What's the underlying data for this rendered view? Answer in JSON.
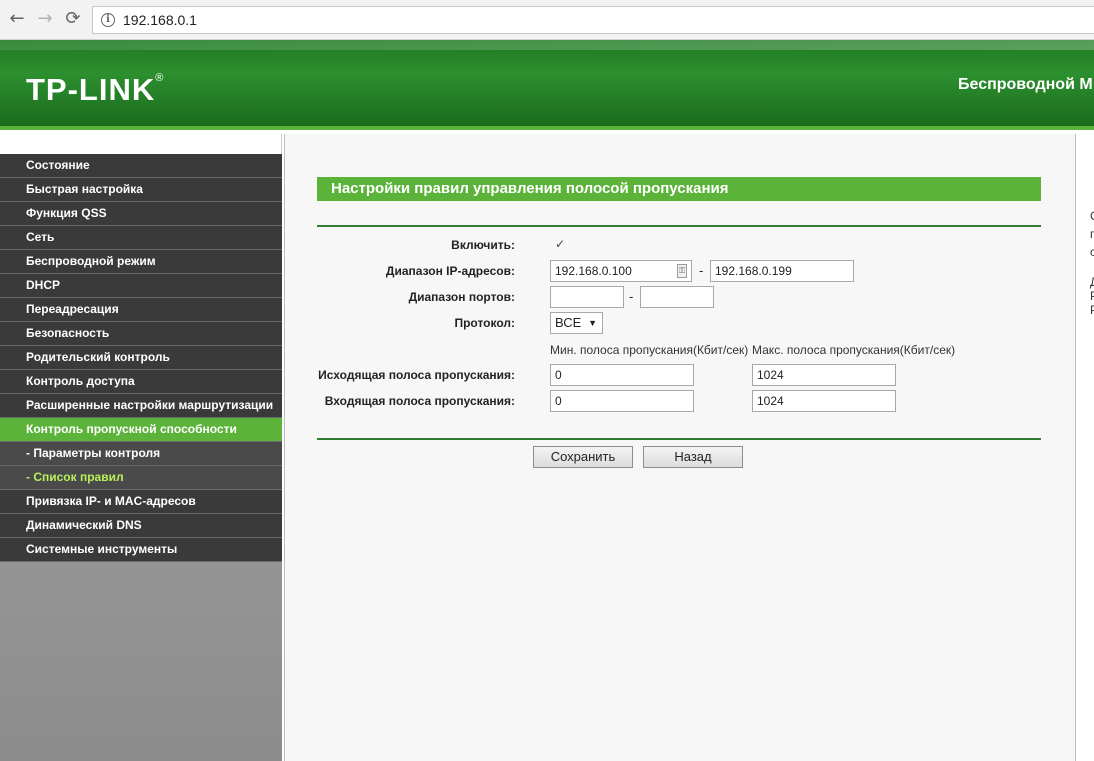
{
  "browser": {
    "url": "192.168.0.1",
    "back_icon": "←",
    "forward_icon": "→",
    "reload_icon": "⟳",
    "info_icon": "i"
  },
  "header": {
    "logo": "TP-LINK",
    "logo_reg": "®",
    "title": "Беспроводной М"
  },
  "sidebar": {
    "items": [
      {
        "label": "Состояние"
      },
      {
        "label": "Быстрая настройка"
      },
      {
        "label": "Функция QSS"
      },
      {
        "label": "Сеть"
      },
      {
        "label": "Беспроводной режим"
      },
      {
        "label": "DHCP"
      },
      {
        "label": "Переадресация"
      },
      {
        "label": "Безопасность"
      },
      {
        "label": "Родительский контроль"
      },
      {
        "label": "Контроль доступа"
      },
      {
        "label": "Расширенные настройки маршрутизации"
      },
      {
        "label": "Контроль пропускной способности"
      },
      {
        "label": "- Параметры контроля"
      },
      {
        "label": "- Список правил"
      },
      {
        "label": "Привязка IP- и MAC-адресов"
      },
      {
        "label": "Динамический DNS"
      },
      {
        "label": "Системные инструменты"
      }
    ]
  },
  "form": {
    "title": "Настройки правил управления полосой пропускания",
    "enable_label": "Включить:",
    "enable_check": "✓",
    "ip_range_label": "Диапазон IP-адресов:",
    "ip_start": "192.168.0.100",
    "ip_end": "192.168.0.199",
    "port_range_label": "Диапазон портов:",
    "port_start": "",
    "port_end": "",
    "protocol_label": "Протокол:",
    "protocol_value": "ВСЕ",
    "min_bw_header": "Мин. полоса пропускания(Кбит/сек)",
    "max_bw_header": "Макс. полоса пропускания(Кбит/сек)",
    "egress_label": "Исходящая полоса пропускания:",
    "egress_min": "0",
    "egress_max": "1024",
    "ingress_label": "Входящая полоса пропускания:",
    "ingress_min": "0",
    "ingress_max": "1024",
    "dash": "-",
    "save_label": "Сохранить",
    "back_label": "Назад"
  },
  "right_panel": {
    "chars": [
      "С",
      "п",
      "с",
      "Д",
      "Р",
      "Р"
    ]
  }
}
